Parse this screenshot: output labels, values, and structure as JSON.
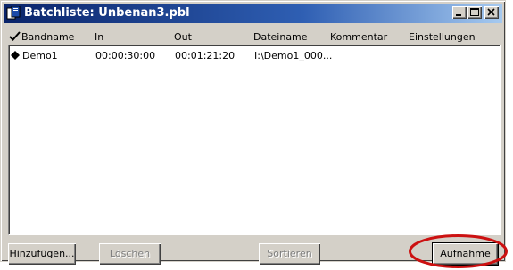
{
  "window": {
    "title": "Batchliste: Unbenan3.pbl"
  },
  "columns": {
    "bandname": "Bandname",
    "in": "In",
    "out": "Out",
    "dateiname": "Dateiname",
    "kommentar": "Kommentar",
    "einstellungen": "Einstellungen"
  },
  "rows": [
    {
      "bandname": "Demo1",
      "in": "00:00:30:00",
      "out": "00:01:21:20",
      "dateiname": "I:\\Demo1_000...",
      "kommentar": "",
      "einstellungen": ""
    }
  ],
  "buttons": {
    "add": "Hinzufügen...",
    "delete": "Löschen",
    "sort": "Sortieren",
    "record": "Aufnahme"
  },
  "annotation": {
    "color": "#cc1111"
  }
}
